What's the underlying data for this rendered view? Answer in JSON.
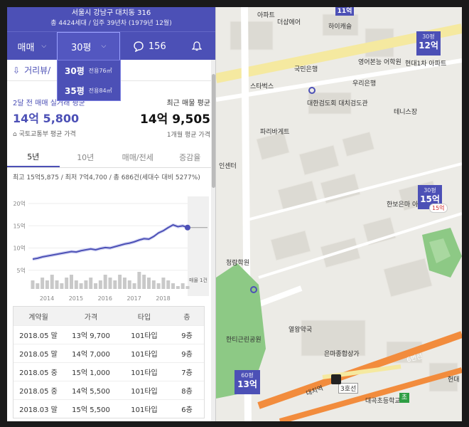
{
  "header": {
    "address": "서울시 강남구 대치동 316",
    "info": "총 4424세대 / 입주 39년차 (1979년 12월)"
  },
  "toolbar": {
    "trade": "매매",
    "size": "30평",
    "comments": "156"
  },
  "size_options": [
    {
      "label": "30평",
      "sub": "전용76㎡"
    },
    {
      "label": "35평",
      "sub": "전용84㎡"
    }
  ],
  "distance_label": "거리뷰/",
  "price_left": {
    "title": "2달 전 매매 실거래 평균",
    "value": "14억 5,800",
    "source": "국토교통부 평균 가격"
  },
  "price_right": {
    "title": "최근 매물 평균",
    "value": "14억 9,505",
    "source": "1개월 평균 가격"
  },
  "tabs": [
    "5년",
    "10년",
    "매매/전세",
    "증감율"
  ],
  "stats_line": "최고 15억5,875 / 최저 7억4,700 / 총 686건(세대수 대비 5277%)",
  "chart_data": {
    "type": "line",
    "y_ticks": [
      "20억",
      "15억",
      "10억",
      "5억"
    ],
    "x_ticks": [
      "2014",
      "2015",
      "2016",
      "2017",
      "2018"
    ],
    "ylim": [
      4,
      20
    ],
    "series": [
      {
        "values": [
          7.5,
          7.7,
          8.0,
          8.2,
          8.4,
          8.6,
          8.8,
          9.0,
          9.2,
          9.1,
          9.4,
          9.6,
          9.8,
          9.6,
          9.9,
          10.1,
          10.0,
          10.3,
          10.6,
          10.9,
          11.1,
          11.4,
          11.8,
          12.1,
          12.0,
          12.6,
          13.4,
          13.9,
          14.6,
          15.2,
          14.8,
          15.0,
          14.6
        ]
      }
    ],
    "volume": [
      3,
      2,
      4,
      3,
      5,
      3,
      2,
      4,
      5,
      3,
      2,
      3,
      4,
      2,
      3,
      5,
      4,
      3,
      5,
      4,
      3,
      2,
      6,
      5,
      4,
      3,
      2,
      4,
      3,
      2,
      1,
      2,
      1
    ],
    "annotation": "매물 1건"
  },
  "table": {
    "headers": [
      "계약월",
      "가격",
      "타입",
      "층"
    ],
    "rows": [
      [
        "2018.05 말",
        "13억 9,700",
        "101타입",
        "9층"
      ],
      [
        "2018.05 말",
        "14억 7,000",
        "101타입",
        "9층"
      ],
      [
        "2018.05 중",
        "15억 1,000",
        "101타입",
        "7층"
      ],
      [
        "2018.05 중",
        "14억 5,500",
        "101타입",
        "8층"
      ],
      [
        "2018.03 말",
        "15억 5,500",
        "101타입",
        "6층"
      ]
    ]
  },
  "map": {
    "labels": [
      "아파트",
      "더샵에어",
      "하이캐슬",
      "국민은행",
      "영어본능 어학원",
      "스타벅스",
      "우리은행",
      "대한검도회 대치검도관",
      "테니스장",
      "파리바게트",
      "현대1차 아파트",
      "인센터",
      "한보은마 아파트",
      "청람학원",
      "한티근린공원",
      "열왕약국",
      "은마종합상가",
      "대곡초등학교",
      "3호선",
      "대치역",
      "6번선",
      "헌대"
    ],
    "pins": [
      {
        "area": "30평",
        "price": "12억"
      },
      {
        "area": "30평",
        "price": "15억",
        "badge": "15억"
      },
      {
        "area": "60평",
        "price": "13억"
      },
      {
        "area": "",
        "price": "11억"
      }
    ]
  }
}
